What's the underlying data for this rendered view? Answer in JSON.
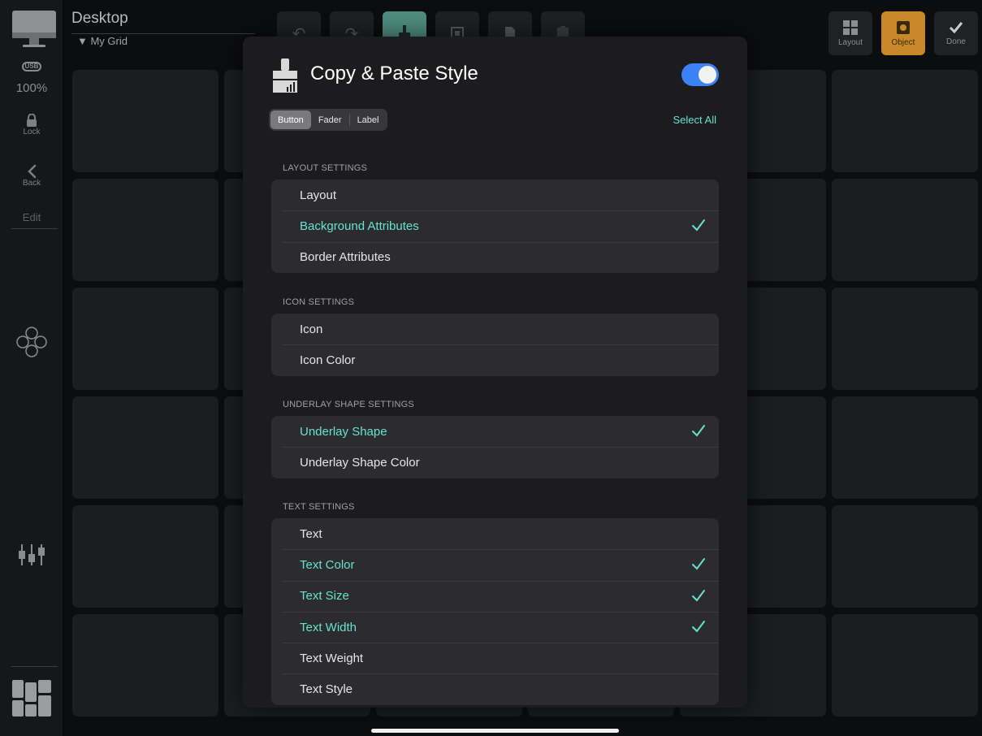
{
  "sidebar": {
    "usb_label": "USB",
    "zoom": "100%",
    "lock_label": "Lock",
    "back_label": "Back",
    "edit_label": "Edit"
  },
  "header": {
    "title": "Desktop",
    "subtitle": "▼ My Grid"
  },
  "toolbar": {
    "undo_icon": "↶",
    "redo_icon": "↷",
    "layout_label": "Layout",
    "object_label": "Object",
    "done_label": "Done"
  },
  "modal": {
    "title": "Copy & Paste Style",
    "toggle_on": true,
    "segments": [
      "Button",
      "Fader",
      "Label"
    ],
    "selected_segment": "Button",
    "select_all": "Select All",
    "sections": [
      {
        "header": "LAYOUT SETTINGS",
        "items": [
          {
            "label": "Layout",
            "checked": false
          },
          {
            "label": "Background Attributes",
            "checked": true
          },
          {
            "label": "Border Attributes",
            "checked": false
          }
        ]
      },
      {
        "header": "ICON SETTINGS",
        "items": [
          {
            "label": "Icon",
            "checked": false
          },
          {
            "label": "Icon Color",
            "checked": false
          }
        ]
      },
      {
        "header": "UNDERLAY SHAPE SETTINGS",
        "items": [
          {
            "label": "Underlay Shape",
            "checked": true
          },
          {
            "label": "Underlay Shape Color",
            "checked": false
          }
        ]
      },
      {
        "header": "TEXT SETTINGS",
        "items": [
          {
            "label": "Text",
            "checked": false
          },
          {
            "label": "Text Color",
            "checked": true
          },
          {
            "label": "Text Size",
            "checked": true
          },
          {
            "label": "Text Width",
            "checked": true
          },
          {
            "label": "Text Weight",
            "checked": false
          },
          {
            "label": "Text Style",
            "checked": false
          }
        ]
      }
    ]
  },
  "colors": {
    "accent": "#66e3d0",
    "toggle": "#3b82f6",
    "object_button": "#c98928"
  }
}
